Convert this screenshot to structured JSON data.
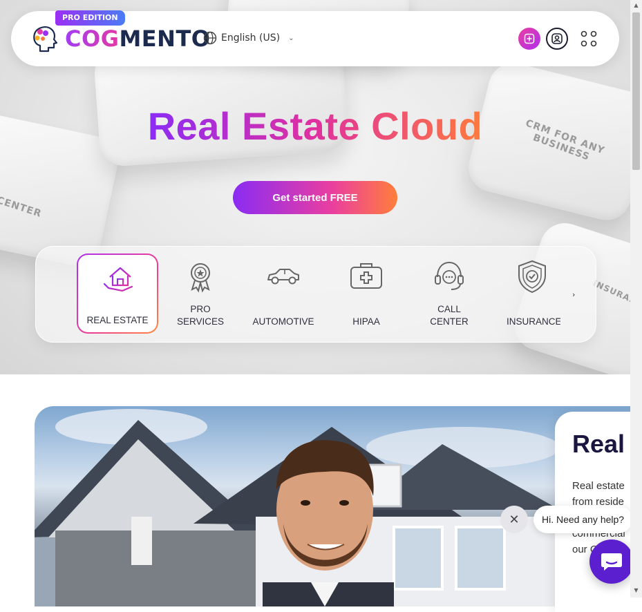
{
  "navbar": {
    "badge": "PRO EDITION",
    "logo_part1": "COG",
    "logo_part2": "MENTO",
    "language": "English (US)"
  },
  "hero": {
    "title": "Real Estate Cloud",
    "cta_label": "Get started FREE",
    "background_keys": [
      "CRM FOR ANY BUSINESS",
      "CENTER",
      "INSURANCE"
    ]
  },
  "industries": {
    "items": [
      {
        "label": "REAL ESTATE",
        "icon": "house-hand-icon",
        "active": true
      },
      {
        "label": "PRO SERVICES",
        "icon": "award-badge-icon",
        "active": false
      },
      {
        "label": "AUTOMOTIVE",
        "icon": "car-icon",
        "active": false
      },
      {
        "label": "HIPAA",
        "icon": "medical-kit-icon",
        "active": false
      },
      {
        "label": "CALL CENTER",
        "icon": "headset-icon",
        "active": false
      },
      {
        "label": "INSURANCE",
        "icon": "shield-check-icon",
        "active": false
      }
    ],
    "next_arrow": "›"
  },
  "section": {
    "card_title": "Real",
    "card_lines": [
      "Real estate",
      "from reside",
      "commercial",
      "our C"
    ]
  },
  "chat": {
    "close": "✕",
    "bubble": "Hi. Need any help?"
  },
  "colors": {
    "gradient_start": "#8a2cf3",
    "gradient_mid": "#e0309f",
    "gradient_end": "#ff7a3c",
    "chat_launcher": "#5b1fd0",
    "logo_dark": "#1b2a4d"
  }
}
